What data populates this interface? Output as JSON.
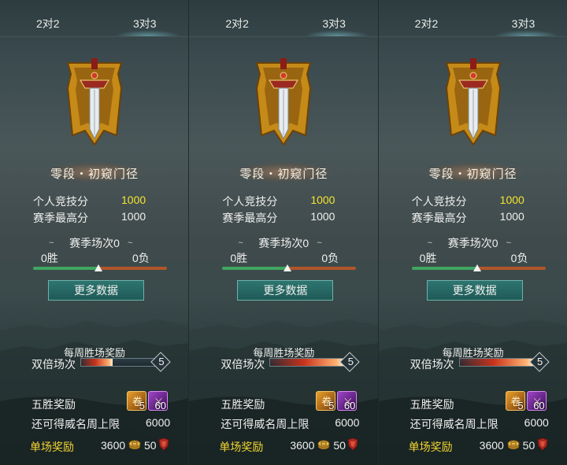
{
  "panels": [
    {
      "tabs": [
        "2对2",
        "3对3"
      ],
      "active_tab": 1,
      "rank_title": "零段・初窥门径",
      "personal_score_label": "个人竞技分",
      "personal_score_value": "1000",
      "season_high_label": "赛季最高分",
      "season_high_value": "1000",
      "season_matches": "赛季场次0",
      "wins": "0胜",
      "losses": "0负",
      "win_ratio": 0.5,
      "more_data_button": "更多数据",
      "weekly_reward_title": "每周胜场奖励",
      "double_label": "双倍场次",
      "double_value": "5",
      "double_fill": 0.4,
      "five_win_label": "五胜奖励",
      "item1_count": "5",
      "item2_count": "60",
      "fame_cap_label": "还可得威名周上限",
      "fame_cap_value": "6000",
      "single_reward_label": "单场奖励",
      "single_coin_value": "3600",
      "single_fame_value": "50"
    },
    {
      "tabs": [
        "2对2",
        "3对3"
      ],
      "active_tab": 1,
      "rank_title": "零段・初窥门径",
      "personal_score_label": "个人竞技分",
      "personal_score_value": "1000",
      "season_high_label": "赛季最高分",
      "season_high_value": "1000",
      "season_matches": "赛季场次0",
      "wins": "0胜",
      "losses": "0负",
      "win_ratio": 0.5,
      "more_data_button": "更多数据",
      "weekly_reward_title": "每周胜场奖励",
      "double_label": "双倍场次",
      "double_value": "5",
      "double_fill": 0.95,
      "five_win_label": "五胜奖励",
      "item1_count": "5",
      "item2_count": "60",
      "fame_cap_label": "还可得威名周上限",
      "fame_cap_value": "6000",
      "single_reward_label": "单场奖励",
      "single_coin_value": "3600",
      "single_fame_value": "50"
    },
    {
      "tabs": [
        "2对2",
        "3对3"
      ],
      "active_tab": 1,
      "rank_title": "零段・初窥门径",
      "personal_score_label": "个人竞技分",
      "personal_score_value": "1000",
      "season_high_label": "赛季最高分",
      "season_high_value": "1000",
      "season_matches": "赛季场次0",
      "wins": "0胜",
      "losses": "0负",
      "win_ratio": 0.5,
      "more_data_button": "更多数据",
      "weekly_reward_title": "每周胜场奖励",
      "double_label": "双倍场次",
      "double_value": "5",
      "double_fill": 0.95,
      "five_win_label": "五胜奖励",
      "item1_count": "5",
      "item2_count": "60",
      "fame_cap_label": "还可得威名周上限",
      "fame_cap_value": "6000",
      "single_reward_label": "单场奖励",
      "single_coin_value": "3600",
      "single_fame_value": "50"
    }
  ],
  "colors": {
    "score_highlight": "#f4e430",
    "single_reward_label": "#f2d530",
    "win_bar": "#3fa660",
    "loss_bar": "#b0552a",
    "button": "#2e7570"
  },
  "icons": {
    "rank_emblem": "sword-banner-icon",
    "item1": "gold-scroll-icon",
    "item2": "purple-sword-icon",
    "coin": "coin-icon",
    "fame": "shield-icon"
  }
}
